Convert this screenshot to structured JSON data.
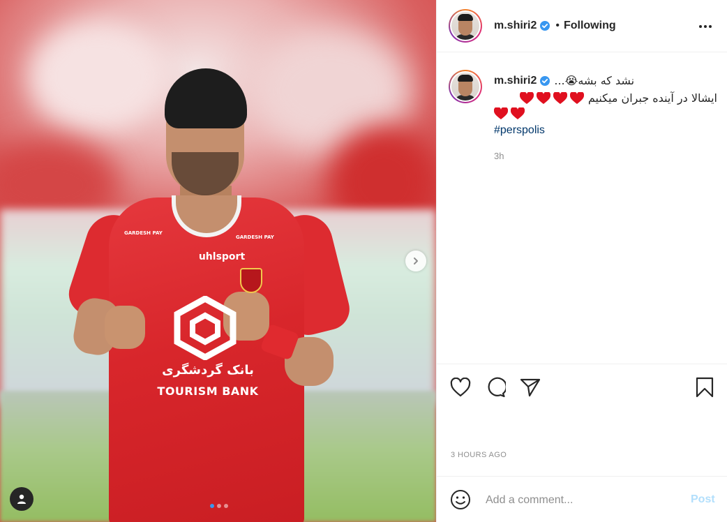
{
  "post": {
    "username": "m.shiri2",
    "verified": true,
    "follow_separator": "•",
    "follow_status": "Following",
    "more_icon": "more-horizontal-icon"
  },
  "photo": {
    "jersey_brand": "uhlsport",
    "sponsor_left": "GARDESH PAY",
    "sponsor_right": "GARDESH PAY",
    "bank_fa": "بانک گردشگری",
    "bank_en": "TOURISM BANK",
    "carousel": {
      "slides": 3,
      "active_index": 0
    },
    "next_icon": "chevron-right-icon",
    "tag_icon": "user-tag-icon"
  },
  "caption": {
    "username": "m.shiri2",
    "line1": "نشد که بشه😭...",
    "line2": "ایشالا در آینده جبران میکنیم",
    "hearts_line2": 4,
    "hearts_line3": 2,
    "hashtag": "#perspolis",
    "time_ago": "3h"
  },
  "actions": {
    "like_icon": "heart-outline-icon",
    "comment_icon": "comment-bubble-icon",
    "share_icon": "paper-plane-icon",
    "save_icon": "bookmark-icon"
  },
  "timestamp": "3 HOURS AGO",
  "comment_box": {
    "emoji_icon": "smiley-icon",
    "placeholder": "Add a comment...",
    "post_label": "Post"
  },
  "colors": {
    "verified_blue": "#3897f0",
    "hashtag": "#00376b",
    "post_disabled": "#b2dffc",
    "heart_red": "#e0101f",
    "jersey_red": "#d8262b"
  }
}
